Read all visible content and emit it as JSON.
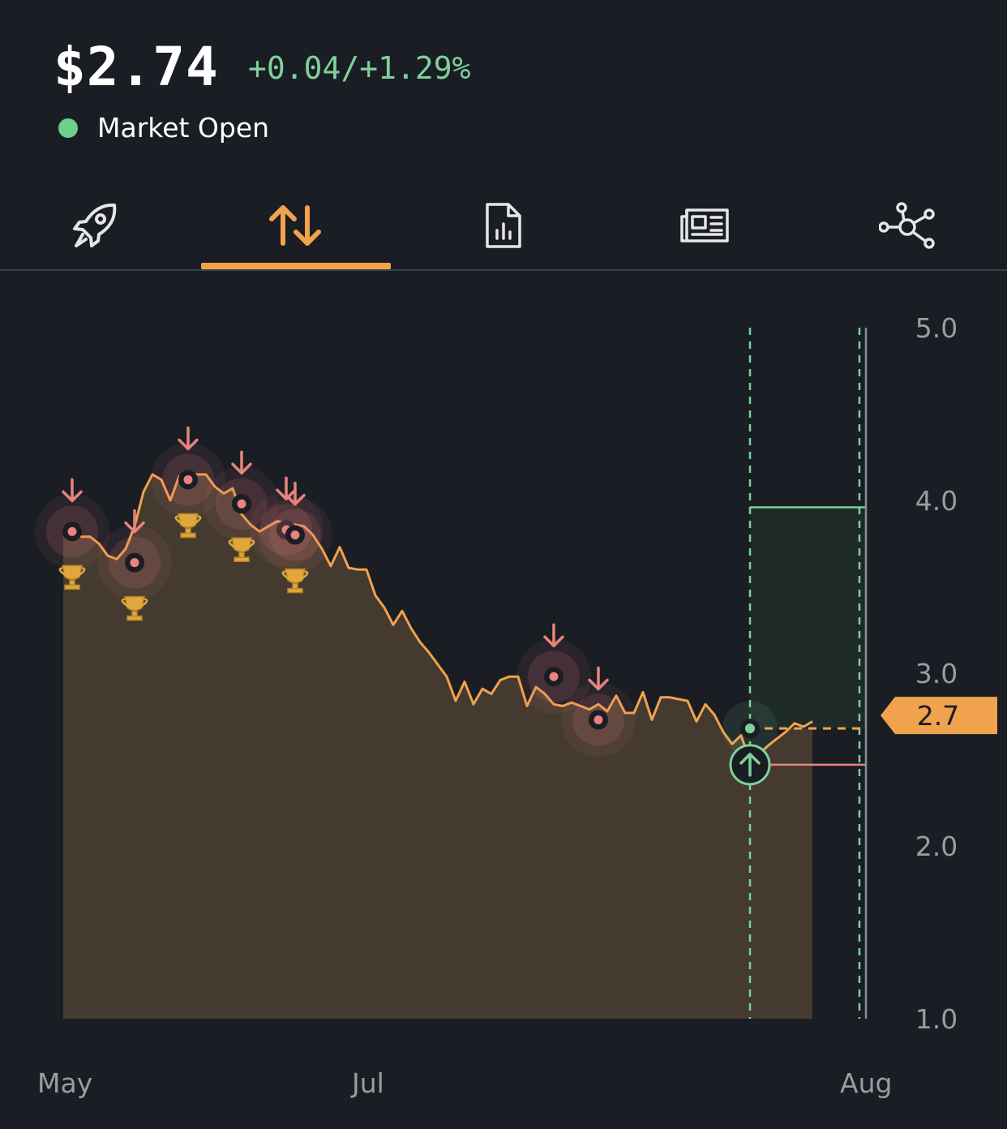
{
  "header": {
    "price": "$2.74",
    "change": "+0.04/+1.29%",
    "status": "Market Open",
    "status_color": "#6ccf8c"
  },
  "tabs": [
    {
      "icon": "rocket-icon",
      "active": false
    },
    {
      "icon": "up-down-arrows-icon",
      "active": true
    },
    {
      "icon": "report-chart-icon",
      "active": false
    },
    {
      "icon": "newspaper-icon",
      "active": false
    },
    {
      "icon": "network-icon",
      "active": false
    }
  ],
  "colors": {
    "background": "#1a1d24",
    "accent": "#f1a24d",
    "positive": "#7fd09a",
    "negative": "#e8837d",
    "area_fill": "#443a2f"
  },
  "chart_data": {
    "type": "area",
    "x_ticks": [
      "May",
      "Jul",
      "Aug"
    ],
    "y_ticks": [
      5.0,
      4.0,
      3.0,
      2.0,
      1.0
    ],
    "ylim": [
      1.0,
      5.0
    ],
    "current_value_label": "2.7",
    "series": [
      {
        "x": [
          0,
          1,
          2,
          3,
          4,
          5,
          6,
          7,
          8,
          9,
          10,
          11,
          12,
          13,
          14,
          15,
          16,
          17,
          18,
          19,
          20,
          21,
          22,
          23,
          24,
          25,
          26,
          27,
          28,
          29,
          30,
          31,
          32,
          33,
          34,
          35,
          36,
          37,
          38,
          39,
          40,
          41,
          42,
          43,
          44,
          45,
          46,
          47,
          48,
          49,
          50,
          51,
          52,
          53,
          54,
          55,
          56,
          57,
          58,
          59,
          60,
          61,
          62,
          63,
          64,
          65,
          66,
          67,
          68,
          69,
          70,
          71,
          72,
          73,
          74,
          75,
          76,
          77,
          78,
          79,
          80,
          81,
          82,
          83,
          84
        ],
        "values": [
          3.82,
          3.8,
          3.79,
          3.79,
          3.75,
          3.68,
          3.66,
          3.72,
          3.85,
          4.05,
          4.15,
          4.12,
          4.0,
          4.14,
          4.16,
          4.15,
          4.15,
          4.08,
          4.04,
          4.07,
          3.92,
          3.86,
          3.82,
          3.85,
          3.88,
          3.87,
          3.86,
          3.85,
          3.8,
          3.72,
          3.62,
          3.73,
          3.61,
          3.6,
          3.6,
          3.45,
          3.38,
          3.28,
          3.36,
          3.26,
          3.18,
          3.12,
          3.05,
          2.98,
          2.84,
          2.95,
          2.82,
          2.91,
          2.88,
          2.96,
          2.98,
          2.98,
          2.81,
          2.92,
          2.88,
          2.82,
          2.81,
          2.83,
          2.81,
          2.79,
          2.82,
          2.78,
          2.87,
          2.77,
          2.77,
          2.89,
          2.73,
          2.86,
          2.86,
          2.85,
          2.84,
          2.72,
          2.82,
          2.76,
          2.66,
          2.59,
          2.64,
          2.49,
          2.53,
          2.58,
          2.62,
          2.66,
          2.71,
          2.69,
          2.72
        ]
      }
    ],
    "sell_markers": [
      {
        "x": 1,
        "y": 3.82,
        "trophy": true
      },
      {
        "x": 8,
        "y": 3.64,
        "trophy": true
      },
      {
        "x": 14,
        "y": 4.12,
        "trophy": true
      },
      {
        "x": 20,
        "y": 3.98,
        "trophy": true
      },
      {
        "x": 25,
        "y": 3.83,
        "trophy": false
      },
      {
        "x": 26,
        "y": 3.8,
        "trophy": true
      },
      {
        "x": 55,
        "y": 2.98,
        "trophy": false
      },
      {
        "x": 60,
        "y": 2.73,
        "trophy": false
      }
    ],
    "buy_marker": {
      "x": 77,
      "y": 2.68
    },
    "trade_box": {
      "x_start": 77,
      "x_end": 90,
      "y_top": 3.96,
      "y_bottom": 2.68,
      "stop": 2.47
    }
  }
}
